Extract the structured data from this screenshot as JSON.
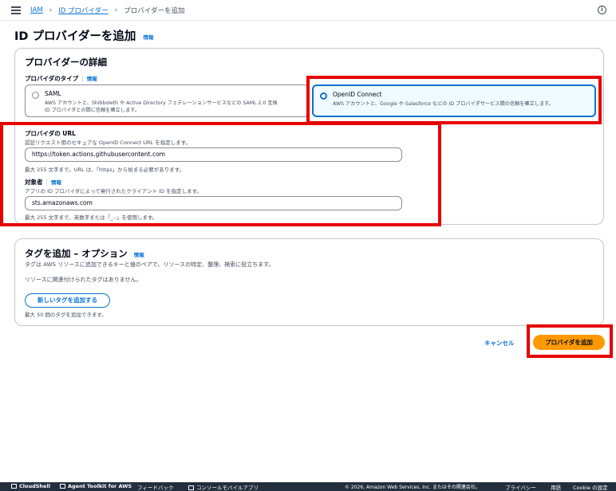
{
  "breadcrumb": {
    "item1": "IAM",
    "item2": "ID プロバイダー",
    "current": "プロバイダーを追加"
  },
  "topbar": {
    "info_icon": "i"
  },
  "page": {
    "title": "ID プロバイダーを追加",
    "info": "情報"
  },
  "details": {
    "title": "プロバイダーの詳細",
    "type_label": "プロバイダのタイプ",
    "type_info": "情報",
    "options": [
      {
        "title": "SAML",
        "desc": "AWS アカウントと、Shibboleth や Active Directory フェデレーションサービスなどの SAML 2.0 互換\nID プロバイダとの間に信頼を確立します。",
        "selected": false
      },
      {
        "title": "OpenID Connect",
        "desc": "AWS アカウントと、Google や Salesforce などの ID プロバイダサービス間の信頼を確立します。",
        "selected": true
      }
    ],
    "url_label": "プロバイダの URL",
    "url_desc": "認証リクエスト用のセキュアな OpenID Connect URL を指定します。",
    "url_value": "https://token.actions.githubusercontent.com",
    "url_hint": "最大 255 文字まで。URL は、「https」から始まる必要があります。",
    "aud_label": "対象者",
    "aud_info": "情報",
    "aud_desc": "アプリの ID プロバイダによって発行されたクライアント ID を指定します。",
    "aud_value": "sts.amazonaws.com",
    "aud_hint": "最大 255 文字まで、英数字または「_.-」を使用します。"
  },
  "tags": {
    "title": "タグを追加 – オプション",
    "info": "情報",
    "desc": "タグは AWS リソースに追加できるキーと値のペアで、リソースの特定、整理、検索に役立ちます。",
    "empty": "リソースに関連付けられたタグはありません。",
    "add_button": "新しいタグを追加する",
    "hint": "最大 50 個のタグを追加できます。"
  },
  "actions": {
    "cancel": "キャンセル",
    "submit": "プロバイダを追加"
  },
  "footer": {
    "cloudshell": "CloudShell",
    "toolkit": "Agent Toolkit for AWS",
    "feedback": "フィードバック",
    "mobile": "コンソールモバイルアプリ",
    "copyright": "© 2026, Amazon Web Services, Inc. またはその関連会社。",
    "privacy": "プライバシー",
    "terms": "用語",
    "cookie": "Cookie の設定"
  },
  "colors": {
    "accent": "#0972d3",
    "primary": "#ff9900",
    "highlight": "#e60000",
    "footer_bg": "#232f3e"
  }
}
